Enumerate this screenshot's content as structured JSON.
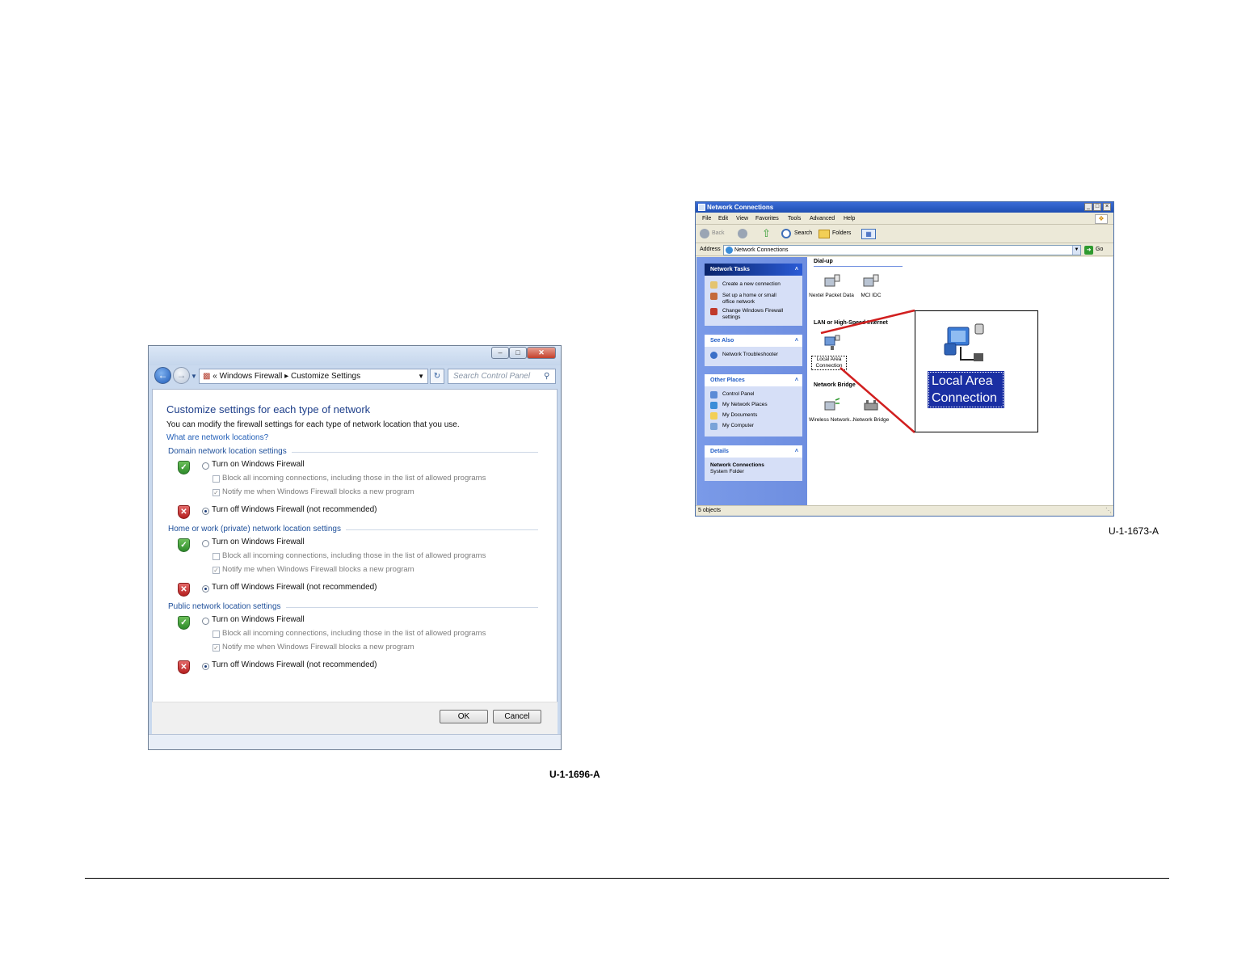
{
  "figure1": {
    "search_placeholder": "Search Control Panel",
    "breadcrumb": {
      "prefix": "«",
      "root": "Windows Firewall",
      "separator": "▸",
      "current": "Customize Settings"
    },
    "heading": "Customize settings for each type of network",
    "description": "You can modify the firewall settings for each type of network location that you use.",
    "help_link": "What are network locations?",
    "sections": [
      {
        "title": "Domain network location settings",
        "turn_on": "Turn on Windows Firewall",
        "block_all": "Block all incoming connections, including those in the list of allowed programs",
        "notify": "Notify me when Windows Firewall blocks a new program",
        "turn_off": "Turn off Windows Firewall (not recommended)"
      },
      {
        "title": "Home or work (private) network location settings",
        "turn_on": "Turn on Windows Firewall",
        "block_all": "Block all incoming connections, including those in the list of allowed programs",
        "notify": "Notify me when Windows Firewall blocks a new program",
        "turn_off": "Turn off Windows Firewall (not recommended)"
      },
      {
        "title": "Public network location settings",
        "turn_on": "Turn on Windows Firewall",
        "block_all": "Block all incoming connections, including those in the list of allowed programs",
        "notify": "Notify me when Windows Firewall blocks a new program",
        "turn_off": "Turn off Windows Firewall (not recommended)"
      }
    ],
    "ok_label": "OK",
    "cancel_label": "Cancel",
    "caption": "U-1-1696-A"
  },
  "figure2": {
    "window_title": "Network Connections",
    "menus": [
      "File",
      "Edit",
      "View",
      "Favorites",
      "Tools",
      "Advanced",
      "Help"
    ],
    "toolbar": {
      "back": "Back",
      "search": "Search",
      "folders": "Folders"
    },
    "address_label": "Address",
    "address_value": "Network Connections",
    "go_label": "Go",
    "network_tasks": {
      "title": "Network Tasks",
      "items": [
        "Create a new connection",
        "Set up a home or small office network",
        "Change Windows Firewall settings"
      ]
    },
    "see_also": {
      "title": "See Also",
      "items": [
        "Network Troubleshooter"
      ]
    },
    "other_places": {
      "title": "Other Places",
      "items": [
        "Control Panel",
        "My Network Places",
        "My Documents",
        "My Computer"
      ]
    },
    "details": {
      "title": "Details",
      "name": "Network Connections",
      "type": "System Folder"
    },
    "groups": {
      "dialup": "Dial-up",
      "lan": "LAN or High-Speed Internet",
      "bridge": "Network Bridge"
    },
    "connections": {
      "nextel": "Nextel Packet Data",
      "mci": "MCI IDC",
      "lan": "Local Area Connection",
      "wireless": "Wireless Network...",
      "bridge": "Network Bridge"
    },
    "status_text": "5 objects",
    "callout_label": "Local Area Connection",
    "caption": "U-1-1673-A"
  },
  "colors": {
    "callout_line": "#d11f1f",
    "xp_titlebar": "#2656c8",
    "w7_heading": "#1e3f8a"
  }
}
